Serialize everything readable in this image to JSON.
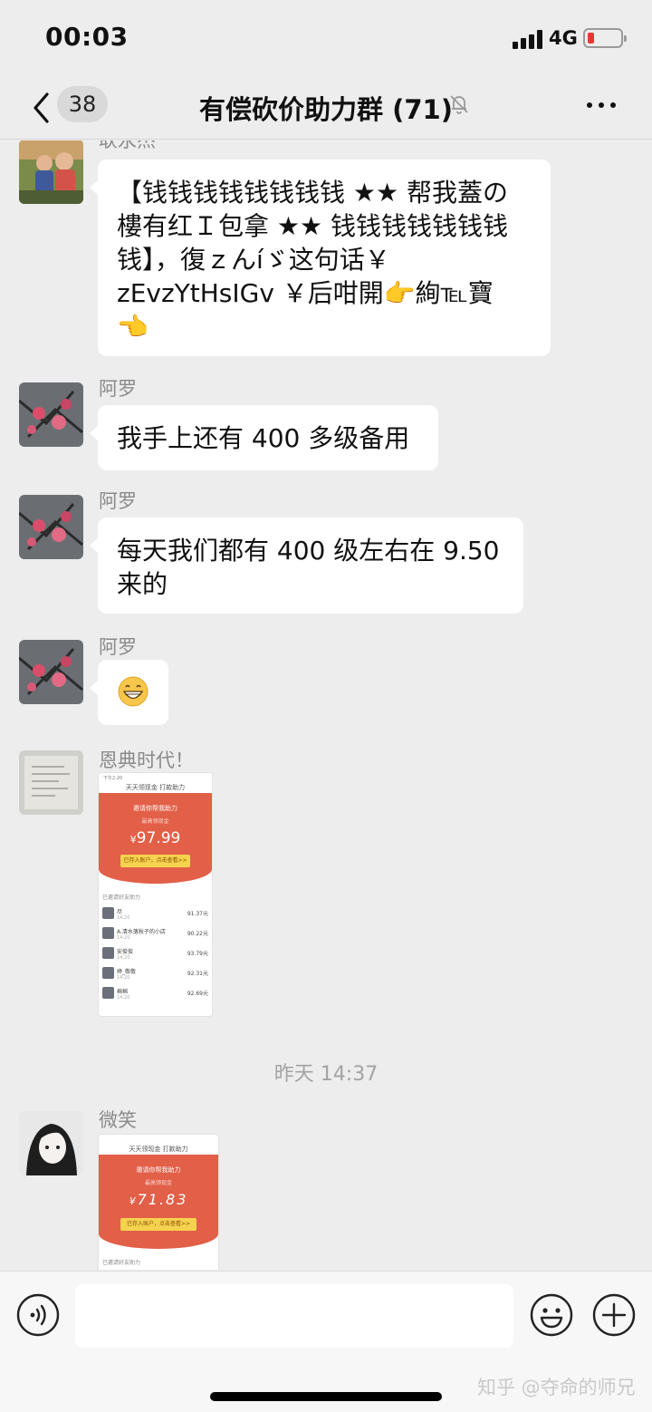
{
  "status_bar": {
    "time": "00:03",
    "network": "4G",
    "battery_level": 0.2,
    "battery_color": "#e53935"
  },
  "nav": {
    "unread_count": "38",
    "title": "有偿砍价助力群 (71)",
    "icons": {
      "back": "chevron-left-icon",
      "muted": "bell-muted-icon",
      "more": "more-dots-icon"
    }
  },
  "messages": [
    {
      "sender": "耿永杰",
      "lines": [
        "【钱钱钱钱钱钱钱钱 ★★ 帮我蓋の",
        "樓有红Ｉ包拿 ★★ 钱钱钱钱钱钱钱",
        "钱】，復ｚんíゞ这句话￥",
        "zEvzYtHsIGv ￥后咁開👉絢℡寶",
        "👈"
      ]
    },
    {
      "sender": "阿罗",
      "lines": [
        "我手上还有 400 多级备用"
      ]
    },
    {
      "sender": "阿罗",
      "lines": [
        "每天我们都有 400 级左右在 9.50",
        "来的"
      ]
    },
    {
      "sender": "阿罗",
      "emoji": "grinning-face-icon"
    },
    {
      "sender": "恩典时代！",
      "screenshot": {
        "status_time": "下午2:20",
        "title": "天天领现金 打款助力",
        "helper_label": "邀请你帮我助力",
        "subtitle": "最高领现金",
        "currency": "¥",
        "amount": "97.99",
        "button": "已存入账户，点击查看>>",
        "section": "已邀请好友助力",
        "rows": [
          {
            "name": "尽",
            "time": "14:20",
            "amount": "91.37元"
          },
          {
            "name": "A.清水落秋子的小店",
            "time": "14:20",
            "amount": "90.22元"
          },
          {
            "name": "安俊俊",
            "time": "14:20",
            "amount": "93.79元"
          },
          {
            "name": "婷_敬敬",
            "time": "14:20",
            "amount": "92.31元"
          },
          {
            "name": "棉棉",
            "time": "14:20",
            "amount": "92.69元"
          }
        ]
      }
    },
    {
      "divider": "昨天 14:37"
    },
    {
      "sender": "微笑",
      "screenshot": {
        "title": "天天领现金 打款助力",
        "helper_label": "邀请你帮我助力",
        "subtitle": "最高领现金",
        "currency": "¥",
        "amount": "71.83",
        "button": "已存入账户，点击查看>>",
        "section": "已邀请好友助力"
      }
    }
  ],
  "input_bar": {
    "placeholder": "",
    "icons": {
      "voice": "voice-icon",
      "emoji": "emoji-icon",
      "plus": "plus-icon"
    },
    "watermark": "知乎 @夺命的师兄"
  },
  "colors": {
    "background": "#ededed",
    "bubble": "#ffffff",
    "accent_red": "#e25f48"
  }
}
